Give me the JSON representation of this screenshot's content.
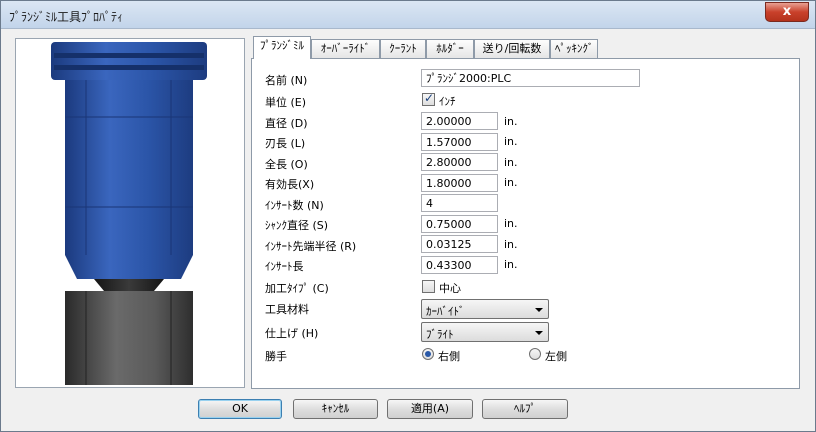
{
  "window": {
    "title": "ﾌﾟﾗﾝｼﾞﾐﾙ工具ﾌﾟﾛﾊﾟﾃｨ",
    "close_glyph": "x"
  },
  "tabs": [
    "ﾌﾟﾗﾝｼﾞﾐﾙ",
    "ｵｰﾊﾞｰﾗｲﾄﾞ",
    "ｸｰﾗﾝﾄ",
    "ﾎﾙﾀﾞｰ",
    "送り/回転数",
    "ﾍﾟｯｷﾝｸﾞ"
  ],
  "form": {
    "name_label": "名前 (N)",
    "name_value": "ﾌﾟﾗﾝｼﾞ2000:PLC",
    "unit_label": "単位 (E)",
    "unit_check_label": "ｲﾝﾁ",
    "diameter_label": "直径 (D)",
    "diameter_value": "2.00000",
    "flute_label": "刃長 (L)",
    "flute_value": "1.57000",
    "overall_label": "全長 (O)",
    "overall_value": "2.80000",
    "effective_label": "有効長(X)",
    "effective_value": "1.80000",
    "inserts_label": "ｲﾝｻｰﾄ数 (N)",
    "inserts_value": "4",
    "shank_label": "ｼｬﾝｸ直径 (S)",
    "shank_value": "0.75000",
    "corner_label": "ｲﾝｻｰﾄ先端半径 (R)",
    "corner_value": "0.03125",
    "insert_len_label": "ｲﾝｻｰﾄ長",
    "insert_len_value": "0.43300",
    "unit_in": "in.",
    "cut_type_label": "加工ﾀｲﾌﾟ (C)",
    "cut_type_check_label": "中心",
    "material_label": "工具材料",
    "material_value": "ｶｰﾊﾞｲﾄﾞ",
    "finish_label": "仕上げ (H)",
    "finish_value": "ﾌﾞﾗｲﾄ",
    "hand_label": "勝手",
    "right_label": "右側",
    "left_label": "左側"
  },
  "buttons": {
    "ok": "OK",
    "cancel": "ｷｬﾝｾﾙ",
    "apply": "適用(A)",
    "help": "ﾍﾙﾌﾟ"
  },
  "colors": {
    "tool_blue": "#2e56a8",
    "holder_gray": "#4a4a4a",
    "window_bg": "#f0f0f0"
  },
  "state": {
    "unit_inch_checked": true,
    "center_cut_checked": false,
    "hand_selected": "right"
  }
}
